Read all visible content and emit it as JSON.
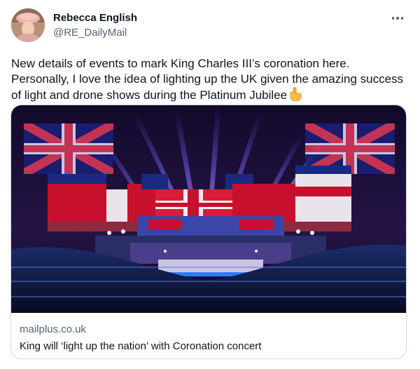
{
  "tweet": {
    "author": {
      "display_name": "Rebecca English",
      "handle": "@RE_DailyMail"
    },
    "text": "New details of events to mark King Charles III’s coronation here. Personally, I love the idea of lighting up the UK given the amazing success of light and drone shows during the Platinum Jubilee",
    "emoji_icon": "pointing-down-hand-icon",
    "card": {
      "domain": "mailplus.co.uk",
      "title": "King will ‘light up the nation’ with Coronation concert",
      "image_icon": "coronation-concert-image"
    }
  },
  "colors": {
    "text_primary": "#0f1419",
    "text_secondary": "#536471",
    "border": "#cfd9de",
    "flag_red": "#c8102e",
    "flag_blue": "#012169"
  }
}
